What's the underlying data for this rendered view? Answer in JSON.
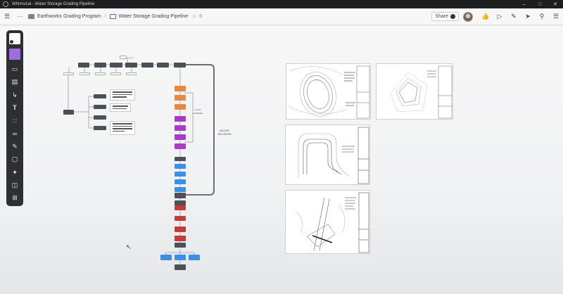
{
  "window": {
    "title": "Whimsical - Water Storage Grading Pipeline",
    "minimize_icon": "minimize-icon",
    "maximize_icon": "maximize-icon",
    "close_icon": "close-icon"
  },
  "topbar": {
    "breadcrumb_folder": "Earthworks Grading Program",
    "breadcrumb_board": "Water Storage Grading Pipeline",
    "star_count": "0",
    "share_label": "Share"
  },
  "canvas": {
    "major_revision_label": "MAJOR\nREVISION",
    "side_loop_label": "IF ANY\nCHANGES"
  },
  "colors": {
    "dark_node": "#4c5158",
    "orange_node": "#e6883f",
    "purple_node": "#a73cc7",
    "blue_node": "#3f8ee6",
    "red_node": "#c43b3b",
    "accent": "#6e5bd6"
  },
  "icons": {
    "rail": [
      "select-icon",
      "sticky-note-icon",
      "device-icon",
      "text-block-icon",
      "connector-arrow-icon",
      "text-icon",
      "grid-icon",
      "link-icon",
      "pen-icon",
      "folder-icon",
      "ai-sparkle-icon",
      "layout-icon",
      "add-icon"
    ],
    "topbar": [
      "hamburger-icon",
      "more-icon",
      "folder-icon",
      "board-icon",
      "star-icon",
      "thumbs-up-icon",
      "present-icon",
      "comment-icon",
      "send-icon",
      "search-icon",
      "menu-icon"
    ]
  }
}
